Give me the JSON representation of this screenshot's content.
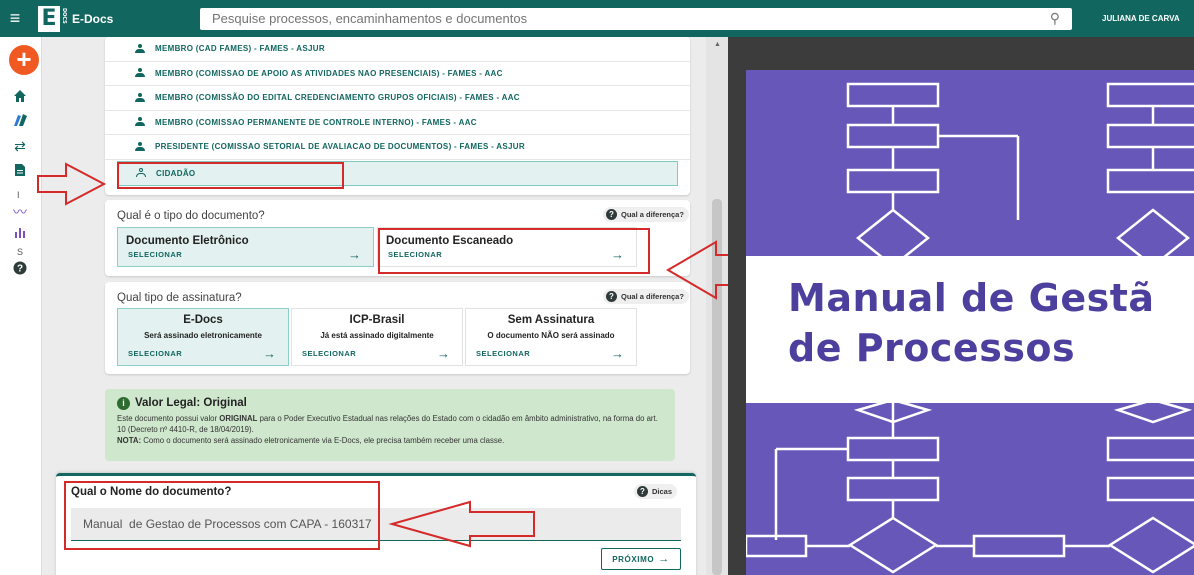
{
  "app": {
    "brand_letter": "E",
    "brand_mini": "DOCS",
    "brand_name": "E-Docs",
    "user": "JULIANA DE CARVA"
  },
  "search": {
    "placeholder": "Pesquise processos, encaminhamentos e documentos"
  },
  "rail": {
    "add_label": "+",
    "text_items": [
      "I",
      "S"
    ]
  },
  "roles": [
    "MEMBRO (CAD FAMES) - FAMES - ASJUR",
    "MEMBRO (COMISSAO DE APOIO AS ATIVIDADES NAO PRESENCIAIS) - FAMES - AAC",
    "MEMBRO (COMISSÃO DO EDITAL CREDENCIAMENTO GRUPOS OFICIAIS) - FAMES - AAC",
    "MEMBRO (COMISSAO PERMANENTE DE CONTROLE INTERNO) - FAMES - AAC",
    "PRESIDENTE (COMISSAO SETORIAL DE AVALIACAO DE DOCUMENTOS) - FAMES - ASJUR",
    "CIDADÃO"
  ],
  "doc_type": {
    "question": "Qual é o tipo do documento?",
    "help": "Qual a diferença?",
    "options": [
      {
        "title": "Documento Eletrônico",
        "action": "SELECIONAR",
        "selected": true
      },
      {
        "title": "Documento Escaneado",
        "action": "SELECIONAR",
        "selected": false
      }
    ]
  },
  "signature": {
    "question": "Qual tipo de assinatura?",
    "help": "Qual a diferença?",
    "options": [
      {
        "title": "E-Docs",
        "desc": "Será assinado eletronicamente",
        "action": "SELECIONAR",
        "selected": true
      },
      {
        "title": "ICP-Brasil",
        "desc": "Já está assinado digitalmente",
        "action": "SELECIONAR",
        "selected": false
      },
      {
        "title": "Sem Assinatura",
        "desc": "O documento NÃO será assinado",
        "action": "SELECIONAR",
        "selected": false
      }
    ]
  },
  "legal": {
    "title": "Valor Legal: Original",
    "text_a": "Este documento possui valor ",
    "text_b": "ORIGINAL",
    "text_c": " para o Poder Executivo Estadual nas relações do Estado com o cidadão em âmbito administrativo, na forma do art. 10 (Decreto nº 4410-R, de 18/04/2019).",
    "note_label": "NOTA:",
    "note_text": " Como o documento será assinado eletronicamente via E-Docs, ele precisa também receber uma classe."
  },
  "name_section": {
    "question": "Qual o Nome do documento?",
    "help": "Dicas",
    "value": "Manual  de Gestao de Processos com CAPA - 160317",
    "next_label": "PRÓXIMO"
  },
  "preview": {
    "title_line1": "Manual de Gestã",
    "title_line2": "de Processos"
  },
  "colors": {
    "primary": "#11665f",
    "accent": "#f05a22",
    "annotation": "#d42a2a",
    "cover_purple": "#6757b9"
  }
}
